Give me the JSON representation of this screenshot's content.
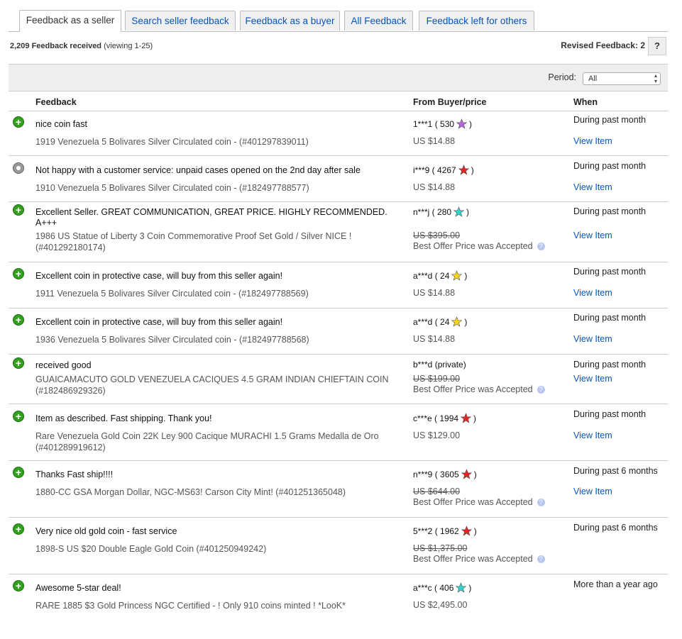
{
  "tabs": [
    {
      "label": "Feedback as a seller"
    },
    {
      "label": "Search seller feedback"
    },
    {
      "label": "Feedback as a buyer"
    },
    {
      "label": "All Feedback"
    },
    {
      "label": "Feedback left for others"
    }
  ],
  "summary": {
    "count": "2,209 Feedback received",
    "viewing": "(viewing 1-25)"
  },
  "revised": {
    "label": "Revised Feedback: 2",
    "help": "?"
  },
  "period": {
    "label": "Period:",
    "value": "All"
  },
  "columns": {
    "feedback": "Feedback",
    "from": "From Buyer/price",
    "when": "When"
  },
  "colors": {
    "positive": "#32a01e",
    "neutral": "#999999",
    "link": "#0654ba",
    "star_purple": "#b366d6",
    "star_red": "#e22626",
    "star_turquoise": "#35d0c8",
    "star_yellow": "#f5d41c"
  },
  "rows": [
    {
      "type": "positive",
      "icon": "positive-feedback-icon",
      "comment": "nice coin fast",
      "item": "1919 Venezuela 5 Bolivares Silver Circulated coin - (#401297839011)",
      "buyer": "1***1 ( 530",
      "star": "purple-star-icon",
      "buyer_end": ")",
      "price": "US $14.88",
      "struck": false,
      "offer": "",
      "when": "During past month",
      "view": "View Item"
    },
    {
      "type": "neutral",
      "icon": "neutral-feedback-icon",
      "comment": "Not happy with a customer service: unpaid cases opened on the 2nd day after sale",
      "item": "1910 Venezuela 5 Bolivares Silver Circulated coin - (#182497788577)",
      "buyer": "i***9 ( 4267",
      "star": "red-star-icon",
      "buyer_end": ")",
      "price": "US $14.88",
      "struck": false,
      "offer": "",
      "when": "During past month",
      "view": "View Item"
    },
    {
      "type": "positive",
      "icon": "positive-feedback-icon",
      "comment": "Excellent Seller. GREAT COMMUNICATION, GREAT PRICE. HIGHLY RECOMMENDED. A+++",
      "item": "1986 US Statue of Liberty 3 Coin Commemorative Proof Set Gold / Silver NICE ! (#401292180174)",
      "buyer": "n***j ( 280",
      "star": "turquoise-star-icon",
      "buyer_end": ")",
      "price": "US $395.00",
      "struck": true,
      "offer": "Best Offer Price was Accepted",
      "when": "During past month",
      "view": "View Item"
    },
    {
      "type": "positive",
      "icon": "positive-feedback-icon",
      "comment": "Excellent coin in protective case, will buy from this seller again!",
      "item": "1911 Venezuela 5 Bolivares Silver Circulated coin - (#182497788569)",
      "buyer": "a***d ( 24",
      "star": "yellow-star-icon",
      "buyer_end": ")",
      "price": "US $14.88",
      "struck": false,
      "offer": "",
      "when": "During past month",
      "view": "View Item"
    },
    {
      "type": "positive",
      "icon": "positive-feedback-icon",
      "comment": "Excellent coin in protective case, will buy from this seller again!",
      "item": "1936 Venezuela 5 Bolivares Silver Circulated coin - (#182497788568)",
      "buyer": "a***d ( 24",
      "star": "yellow-star-icon",
      "buyer_end": ")",
      "price": "US $14.88",
      "struck": false,
      "offer": "",
      "when": "During past month",
      "view": "View Item"
    },
    {
      "type": "positive",
      "icon": "positive-feedback-icon",
      "comment": "received good",
      "item": "GUAICAMACUTO GOLD VENEZUELA CACIQUES 4.5 GRAM INDIAN CHIEFTAIN COIN (#182486929326)",
      "buyer": "b***d (private)",
      "star": "",
      "buyer_end": "",
      "price": "US $199.00",
      "struck": true,
      "offer": "Best Offer Price was Accepted",
      "when": "During past month",
      "view": "View Item"
    },
    {
      "type": "positive",
      "icon": "positive-feedback-icon",
      "comment": "Item as described. Fast shipping. Thank you!",
      "item": "Rare Venezuela Gold Coin 22K Ley 900 Cacique MURACHI 1.5 Grams Medalla de Oro (#401289919612)",
      "buyer": "c***e ( 1994",
      "star": "red-star-icon",
      "buyer_end": ")",
      "price": "US $129.00",
      "struck": false,
      "offer": "",
      "when": "During past month",
      "view": "View Item"
    },
    {
      "type": "positive",
      "icon": "positive-feedback-icon",
      "comment": "Thanks Fast ship!!!!",
      "item": "1880-CC GSA Morgan Dollar, NGC-MS63! Carson City Mint! (#401251365048)",
      "buyer": "n***9 ( 3605",
      "star": "red-star-icon",
      "buyer_end": ")",
      "price": "US $644.00",
      "struck": true,
      "offer": "Best Offer Price was Accepted",
      "when": "During past 6 months",
      "view": "View Item"
    },
    {
      "type": "positive",
      "icon": "positive-feedback-icon",
      "comment": "Very nice old gold coin - fast service",
      "item": "1898-S US $20 Double Eagle Gold Coin (#401250949242)",
      "buyer": "5***2 ( 1962",
      "star": "red-star-icon",
      "buyer_end": ")",
      "price": "US $1,375.00",
      "struck": true,
      "offer": "Best Offer Price was Accepted",
      "when": "During past 6 months",
      "view": ""
    },
    {
      "type": "positive",
      "icon": "positive-feedback-icon",
      "comment": "Awesome 5-star deal!",
      "item": "RARE 1885 $3 Gold Princess NGC Certified - ! Only 910 coins minted ! *LooK*",
      "buyer": "a***c ( 406",
      "star": "turquoise-star-icon",
      "buyer_end": ")",
      "price": "US $2,495.00",
      "struck": false,
      "offer": "",
      "when": "More than a year ago",
      "view": ""
    }
  ]
}
